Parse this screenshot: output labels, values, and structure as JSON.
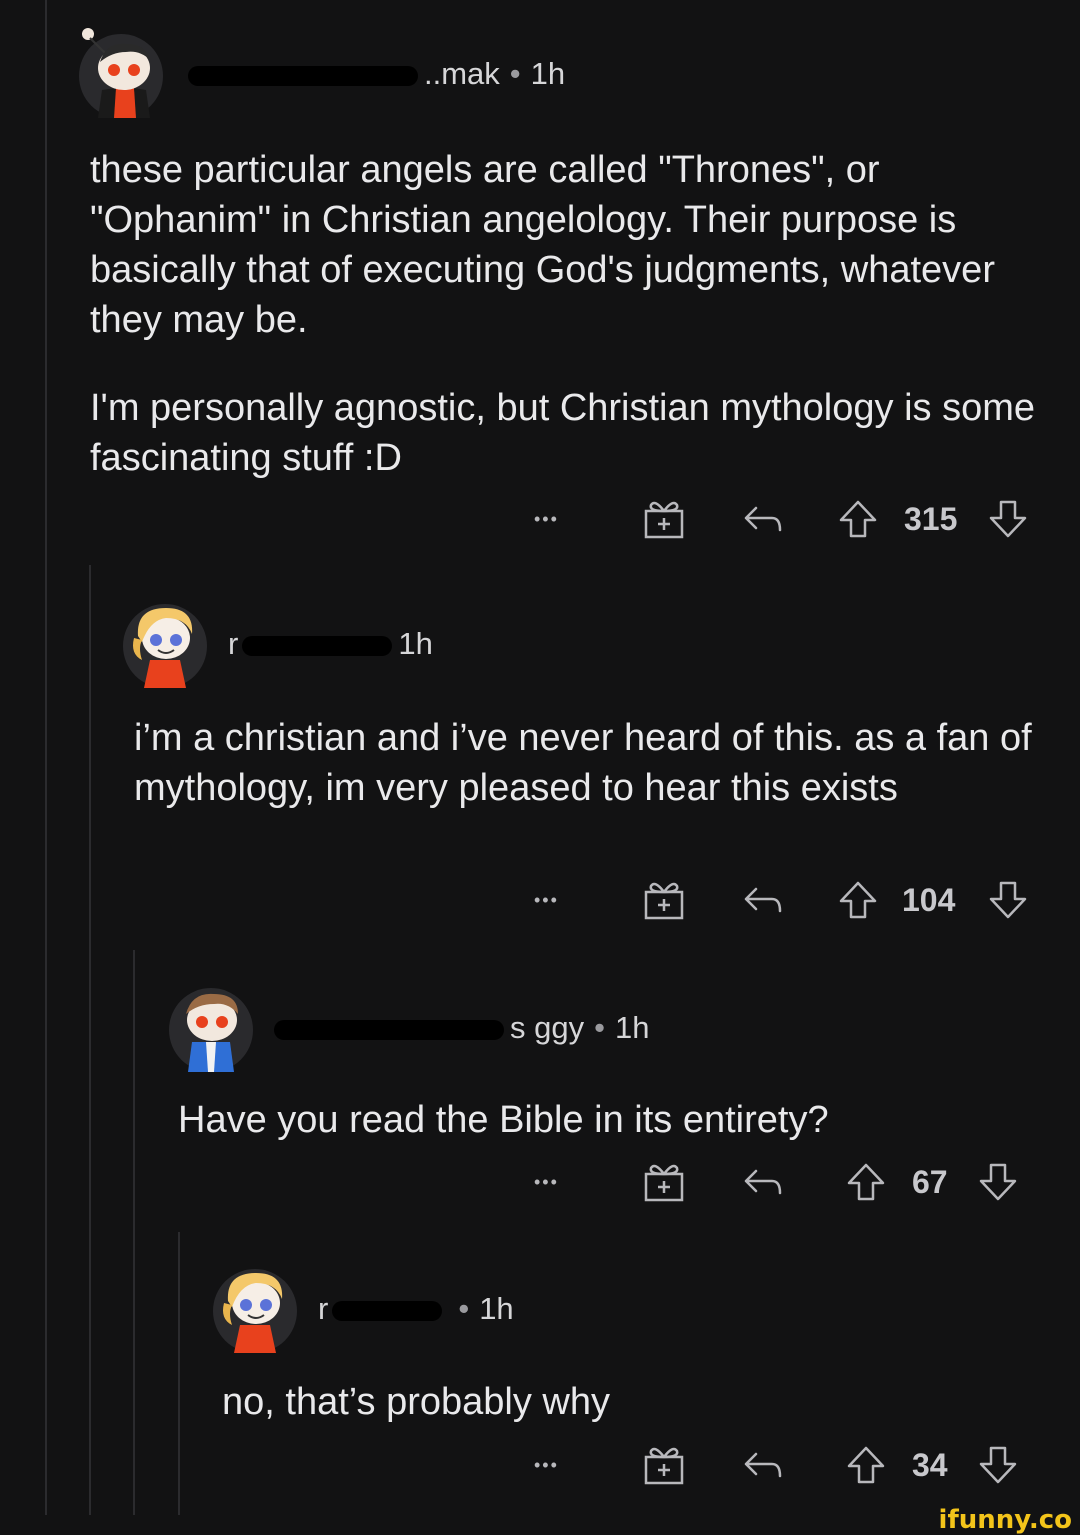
{
  "comments": [
    {
      "username_visible": "..mak",
      "time": "1h",
      "paragraphs": [
        "these particular angels are called \"Thrones\", or \"Ophanim\" in Christian angelology. Their purpose is basically that of executing God's judgments, whatever they may be.",
        "I'm personally agnostic, but Christian mythology is some fascinating stuff :D"
      ],
      "more": "•••",
      "score": "315"
    },
    {
      "username_visible": "r",
      "time": "1h",
      "paragraphs": [
        "i’m a christian and i’ve never heard of this. as a fan of mythology, im very pleased to hear this exists"
      ],
      "more": "•••",
      "score": "104"
    },
    {
      "username_visible": "s ggy",
      "time": "1h",
      "paragraphs": [
        "Have you read the Bible in its entirety?"
      ],
      "more": "•••",
      "score": "67"
    },
    {
      "username_visible": "r",
      "time": "1h",
      "paragraphs": [
        "no, that’s probably why"
      ],
      "more": "•••",
      "score": "34"
    }
  ],
  "watermark": "ifunny.co"
}
